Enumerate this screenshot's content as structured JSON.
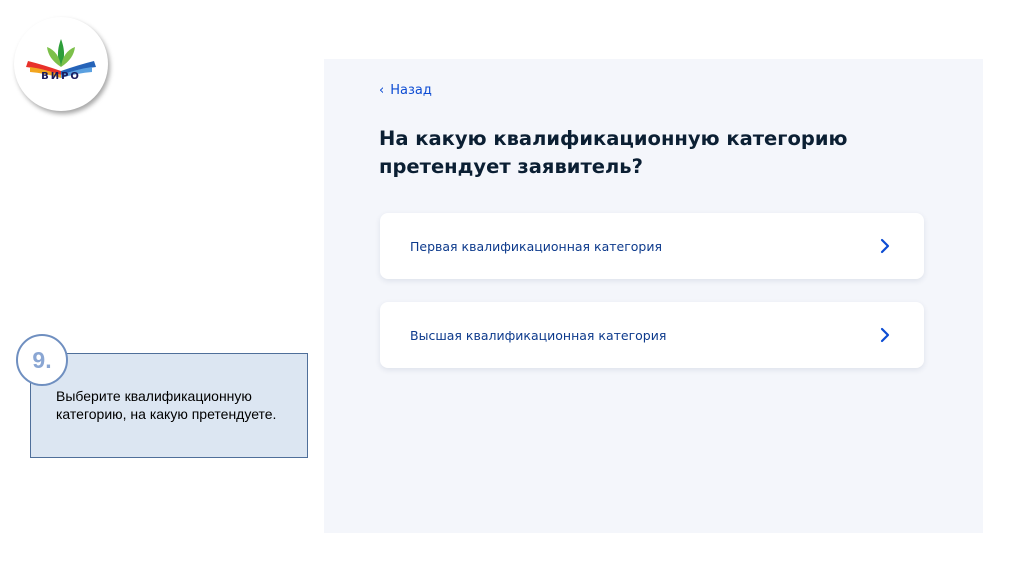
{
  "logo": {
    "text": "ВИРО"
  },
  "form": {
    "back_label": "Назад",
    "question": "На какую квалификационную категорию претендует заявитель?",
    "options": [
      {
        "label": "Первая квалификационная категория"
      },
      {
        "label": "Высшая квалификационная категория"
      }
    ]
  },
  "instruction": {
    "step": "9.",
    "text": "Выберите квалификационную категорию, на какую претендуете."
  },
  "colors": {
    "accent": "#0d4cd3",
    "option_text": "#0d3a8c",
    "panel_bg": "#f4f6fb",
    "note_bg": "#dce6f2"
  },
  "icons": [
    "chevron-left-icon",
    "chevron-right-icon"
  ]
}
